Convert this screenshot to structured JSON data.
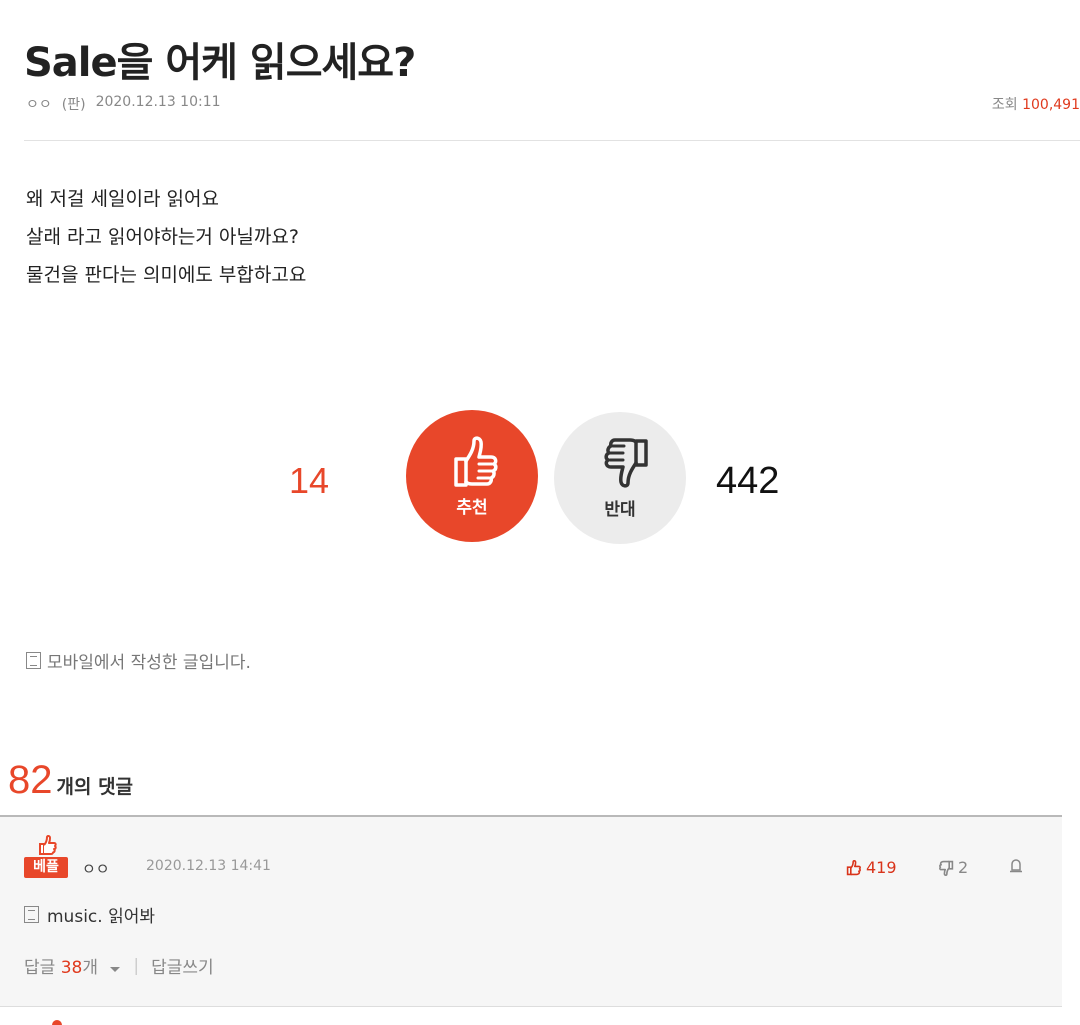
{
  "post": {
    "title": "Sale을 어케 읽으세요?",
    "author": "ㅇㅇ",
    "source": "(판)",
    "date": "2020.12.13 10:11",
    "views_label": "조회",
    "views_count": "100,491",
    "body_lines": [
      "왜 저걸 세일이라 읽어요",
      "살래 라고 읽어야하는거 아닐까요?",
      "물건을 판다는 의미에도 부합하고요"
    ],
    "mobile_note": "모바일에서 작성한 글입니다."
  },
  "votes": {
    "up_count": "14",
    "up_label": "추천",
    "down_label": "반대",
    "down_count": "442"
  },
  "comments_header": {
    "count": "82",
    "label": "개의 댓글"
  },
  "comment": {
    "badge": "베플",
    "author": "ㅇㅇ",
    "date": "2020.12.13 14:41",
    "up_count": "419",
    "down_count": "2",
    "text": "music. 읽어봐",
    "replies_label": "답글",
    "replies_count": "38",
    "replies_suffix": "개",
    "write_reply": "답글쓰기"
  },
  "colors": {
    "accent": "#e8472a",
    "down_circle": "#ececec",
    "comment_bg": "#f6f6f6"
  },
  "icons": [
    "thumbs-up-icon",
    "thumbs-down-icon",
    "document-icon",
    "report-icon",
    "caret-down-icon"
  ]
}
